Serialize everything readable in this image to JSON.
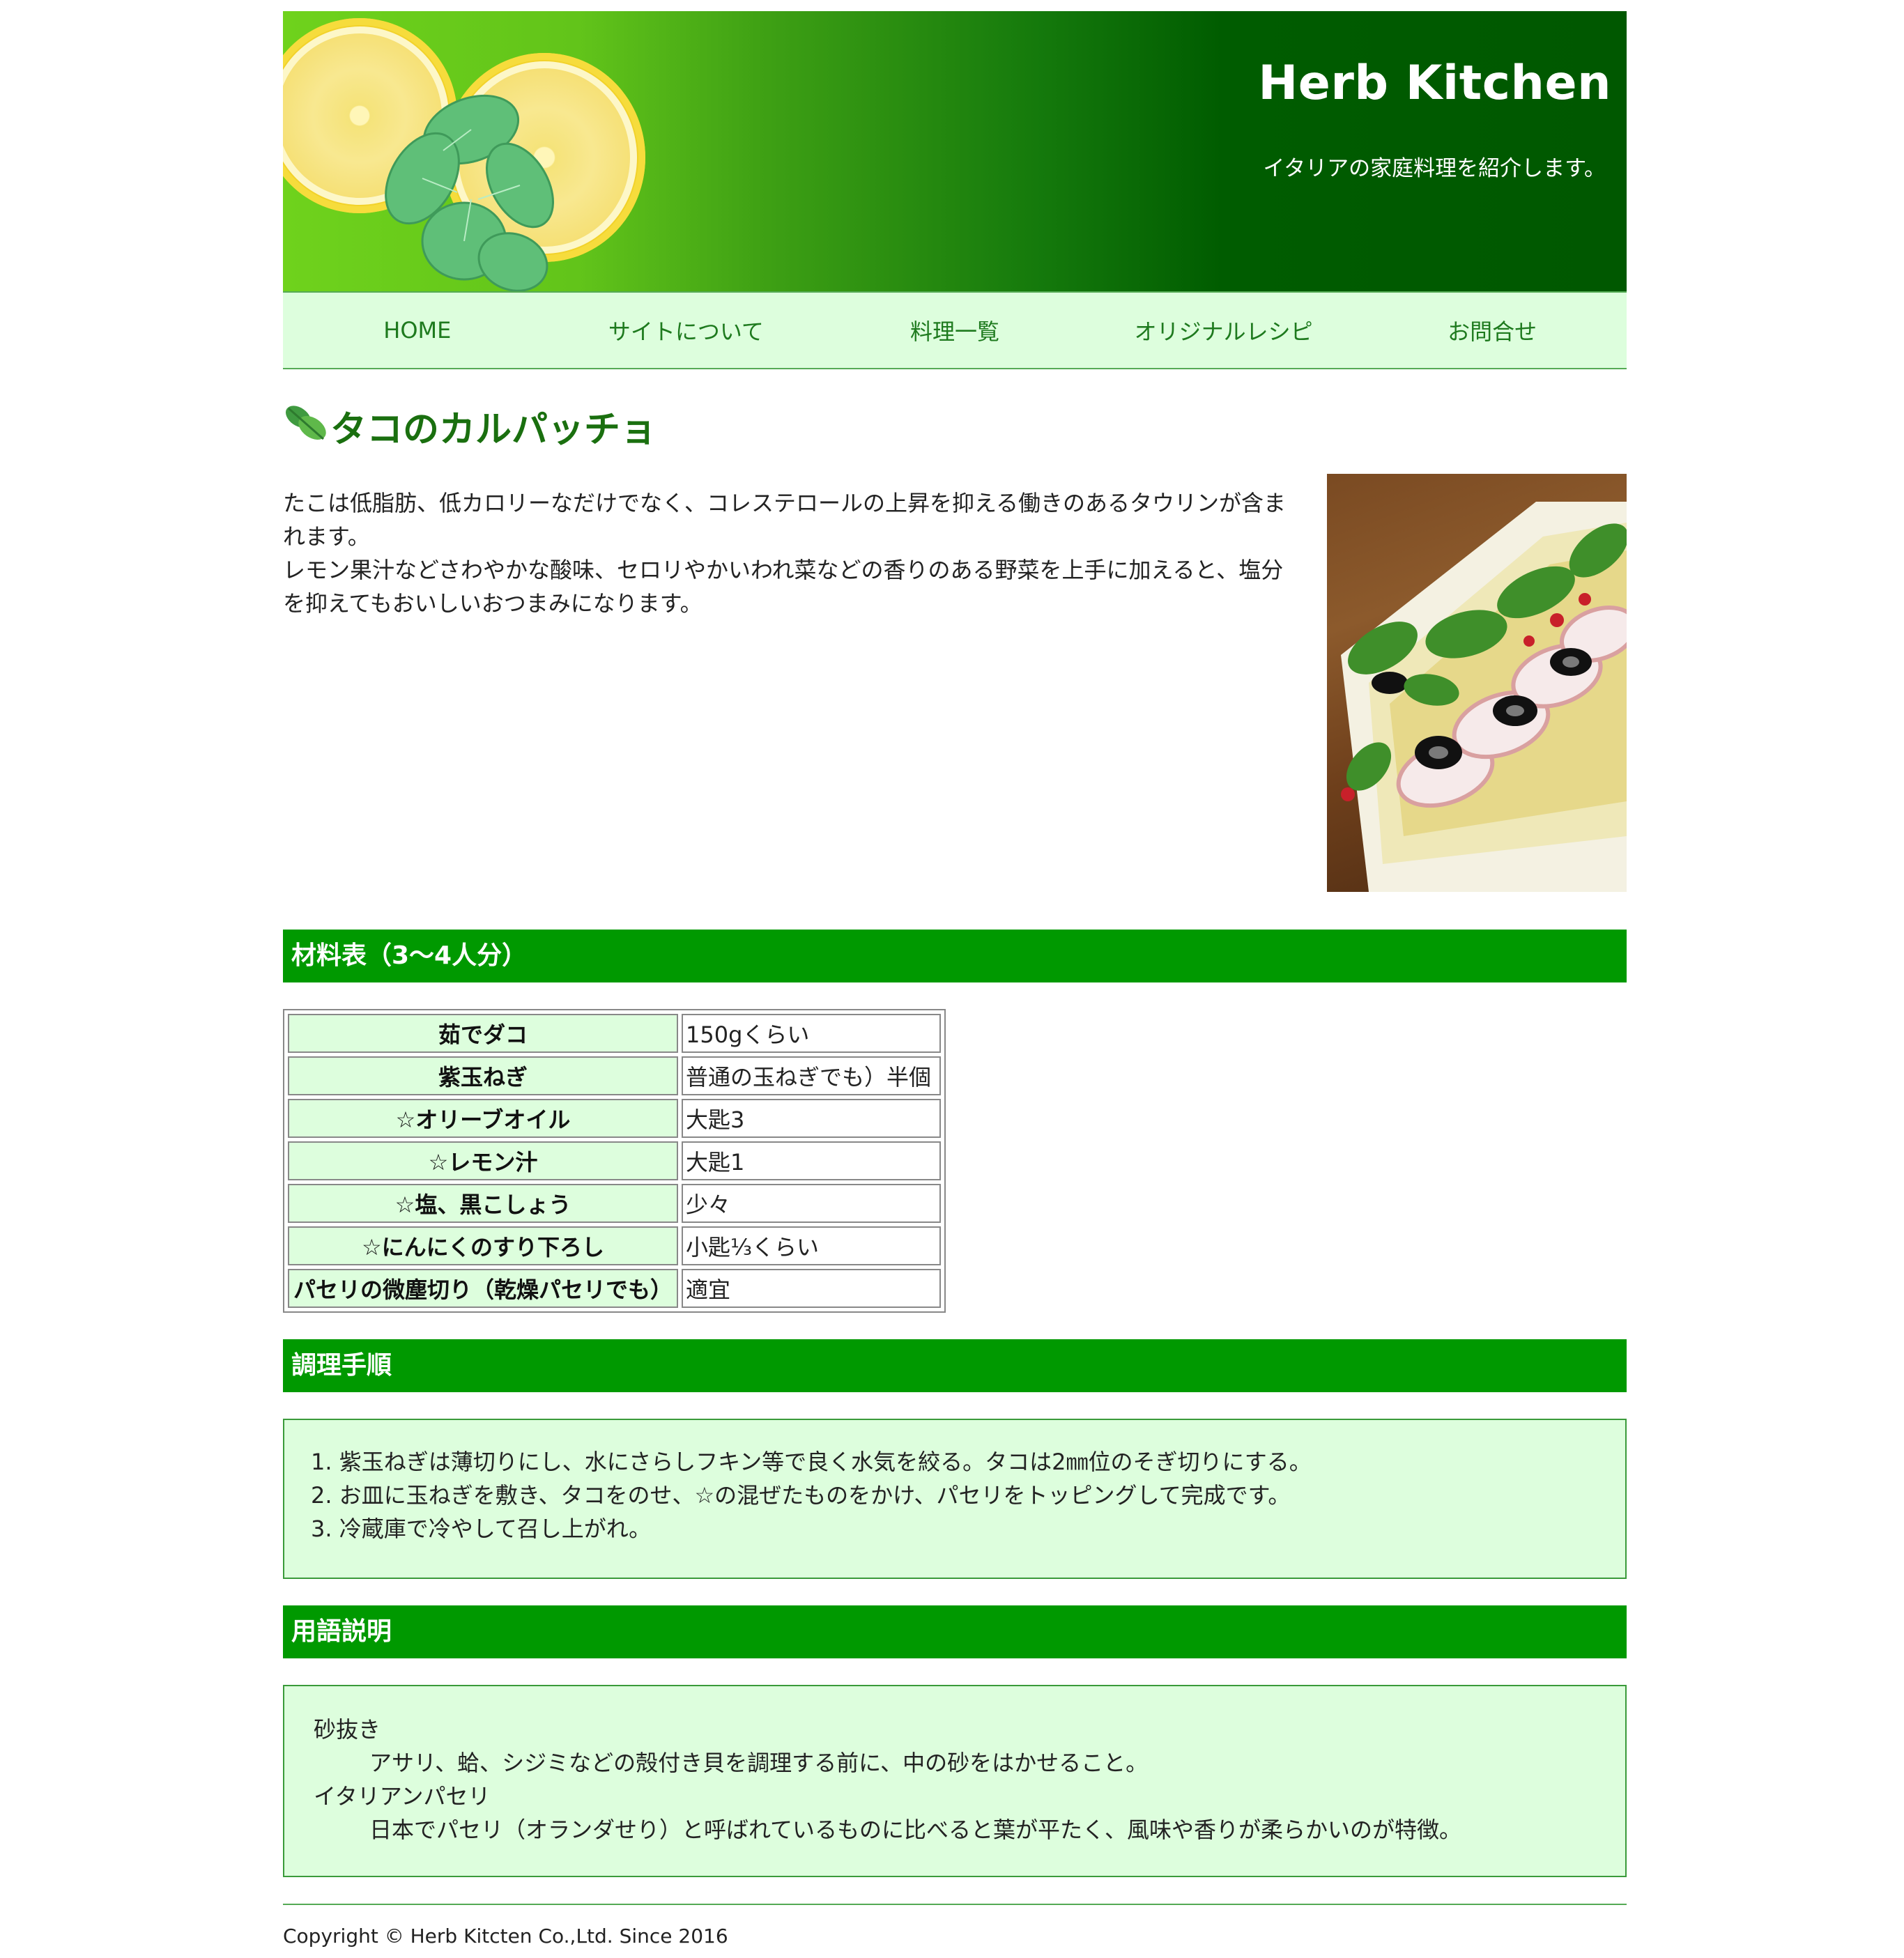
{
  "header": {
    "site_title": "Herb Kitchen",
    "tagline": "イタリアの家庭料理を紹介します。"
  },
  "nav": {
    "items": [
      {
        "label": "HOME"
      },
      {
        "label": "サイトについて"
      },
      {
        "label": "料理一覧"
      },
      {
        "label": "オリジナルレシピ"
      },
      {
        "label": "お問合せ"
      }
    ]
  },
  "recipe": {
    "title": "タコのカルパッチョ",
    "intro_1": "たこは低脂肪、低カロリーなだけでなく、コレステロールの上昇を抑える働きのあるタウリンが含まれます。",
    "intro_2": "レモン果汁などさわやかな酸味、セロリやかいわれ菜などの香りのある野菜を上手に加えると、塩分を抑えてもおいしいおつまみになります。"
  },
  "ingredients": {
    "heading": "材料表（3〜4人分）",
    "rows": [
      {
        "name": "茹でダコ",
        "qty": "150gくらい"
      },
      {
        "name": "紫玉ねぎ",
        "qty": "普通の玉ねぎでも）半個"
      },
      {
        "name": "☆オリーブオイル",
        "qty": "大匙3"
      },
      {
        "name": "☆レモン汁",
        "qty": "大匙1"
      },
      {
        "name": "☆塩、黒こしょう",
        "qty": "少々"
      },
      {
        "name": "☆にんにくのすり下ろし",
        "qty": "小匙⅓くらい"
      },
      {
        "name": "パセリの微塵切り（乾燥パセリでも）",
        "qty": "適宜"
      }
    ]
  },
  "steps": {
    "heading": "調理手順",
    "items": [
      "1. 紫玉ねぎは薄切りにし、水にさらしフキン等で良く水気を絞る。タコは2㎜位のそぎ切りにする。",
      "2. お皿に玉ねぎを敷き、タコをのせ、☆の混ぜたものをかけ、パセリをトッピングして完成です。",
      "3. 冷蔵庫で冷やして召し上がれ。"
    ]
  },
  "glossary": {
    "heading": "用語説明",
    "terms": [
      {
        "term": "砂抜き",
        "definition": "アサリ、蛤、シジミなどの殻付き貝を調理する前に、中の砂をはかせること。"
      },
      {
        "term": "イタリアンパセリ",
        "definition": "日本でパセリ（オランダせり）と呼ばれているものに比べると葉が平たく、風味や香りが柔らかいのが特徴。"
      }
    ]
  },
  "footer": {
    "copyright": "Copyright © Herb Kitcten Co.,Ltd. Since 2016"
  },
  "colors": {
    "header_dark": "#005800",
    "header_light": "#6fd21c",
    "nav_bg": "#ddfedd",
    "section_bar": "#009900",
    "title_green": "#1a6f0f"
  }
}
